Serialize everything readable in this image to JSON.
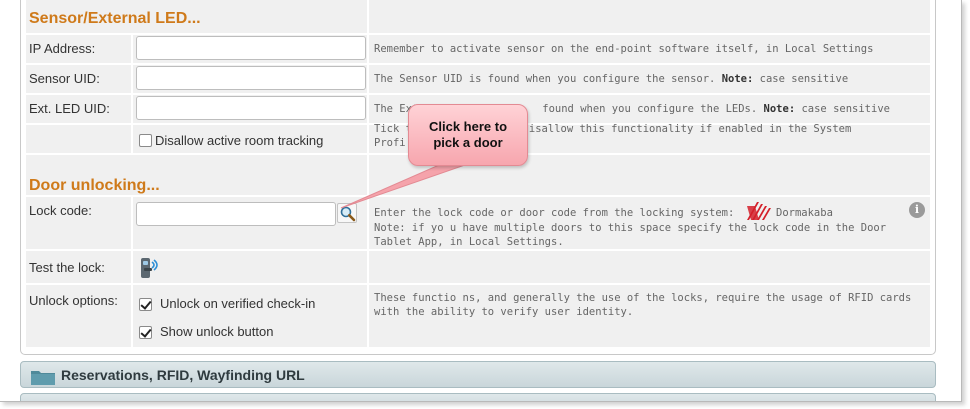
{
  "sensor_section": {
    "title": "Sensor/External LED...",
    "ip_label": "IP Address:",
    "ip_value": "",
    "ip_hint": "Remember to activate sensor on the end-point software itself, in Local Settings",
    "uid_label": "Sensor UID:",
    "uid_value": "",
    "uid_hint_text": "The Sensor UID is found when you configure the sensor.",
    "uid_hint_note": "Note:",
    "uid_hint_tail": "case sensitive",
    "led_label": "Ext. LED UID:",
    "led_value": "",
    "led_hint_text": "The Ext",
    "led_hint_text2": "found when you configure the LEDs.",
    "led_hint_note": "Note:",
    "led_hint_tail": "case sensitive",
    "disallow_label": "Disallow active room tracking",
    "disallow_checked": false,
    "disallow_hint_1": "Tick t",
    "disallow_hint_1b": "o disallow this functionality if enabled in the System",
    "disallow_hint_2": "Profi"
  },
  "door_section": {
    "title": "Door unlocking...",
    "lock_label": "Lock code:",
    "lock_value": "",
    "lock_hint": "Enter the lock code or door code from the locking system:",
    "lock_brand": "Dormakaba",
    "lock_note_1": "Note: if yo u have multiple doors to this space specify the lock code in the Door",
    "lock_note_2": "Tablet App, in Local Settings.",
    "test_label": "Test the lock:",
    "unlock_label": "Unlock options:",
    "opt_verified": "Unlock on verified check-in",
    "opt_verified_checked": true,
    "opt_show": "Show unlock button",
    "opt_show_checked": true,
    "unlock_hint_1": "These functio ns, and generally the use of the locks, require the usage of RFID cards",
    "unlock_hint_2": "with the ability to verify user identity."
  },
  "callout": {
    "line1": "Click here to",
    "line2": "pick a door"
  },
  "collapsed_sections": {
    "reservations": "Reservations, RFID, Wayfinding URL"
  },
  "colors": {
    "section_title": "#cf7a1a",
    "callout_fill": "#f7a6ae",
    "bar_fill": "#c9d6da"
  },
  "icons": {
    "search": "magnifier-icon",
    "info": "info-icon",
    "lock": "door-lock-icon",
    "brand": "dormakaba-logo",
    "folder": "folder-icon"
  }
}
